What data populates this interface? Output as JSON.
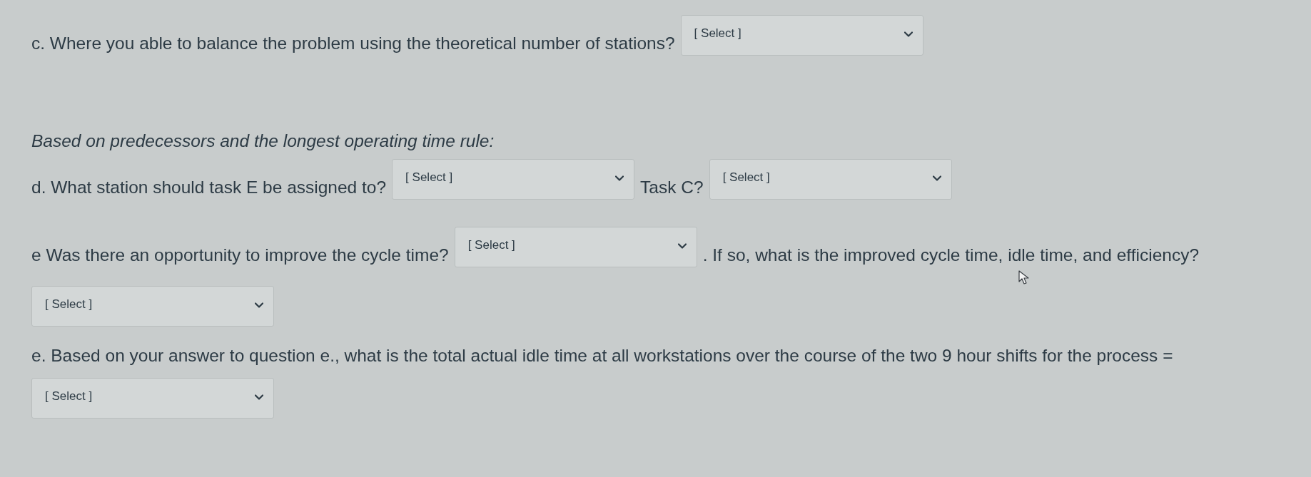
{
  "lines": [
    {
      "kind": "row",
      "parts": [
        {
          "kind": "text",
          "text": "c. Where you able to balance the problem using the theoretical number of stations?"
        },
        {
          "kind": "select",
          "value": "[ Select ]"
        }
      ]
    },
    {
      "kind": "note",
      "text": "Based on predecessors and the longest operating time rule:"
    },
    {
      "kind": "row",
      "parts": [
        {
          "kind": "text",
          "text": "d. What station should task E be assigned to?"
        },
        {
          "kind": "select",
          "value": "[ Select ]"
        },
        {
          "kind": "text",
          "text": "Task C?"
        },
        {
          "kind": "select",
          "value": "[ Select ]"
        }
      ]
    },
    {
      "kind": "row",
      "parts": [
        {
          "kind": "text",
          "text": "e Was there an opportunity to improve the cycle time?"
        },
        {
          "kind": "select",
          "value": "[ Select ]"
        },
        {
          "kind": "text",
          "text": ". If so, what is the improved cycle time, idle time, and efficiency?"
        }
      ]
    },
    {
      "kind": "row",
      "parts": [
        {
          "kind": "select",
          "value": "[ Select ]"
        }
      ]
    },
    {
      "kind": "row",
      "parts": [
        {
          "kind": "text",
          "text": "e. Based on your answer to question e., what is the total actual idle time at all workstations over the course of the two 9 hour shifts for the process ="
        }
      ]
    },
    {
      "kind": "row",
      "parts": [
        {
          "kind": "select",
          "value": "[ Select ]"
        }
      ]
    }
  ]
}
